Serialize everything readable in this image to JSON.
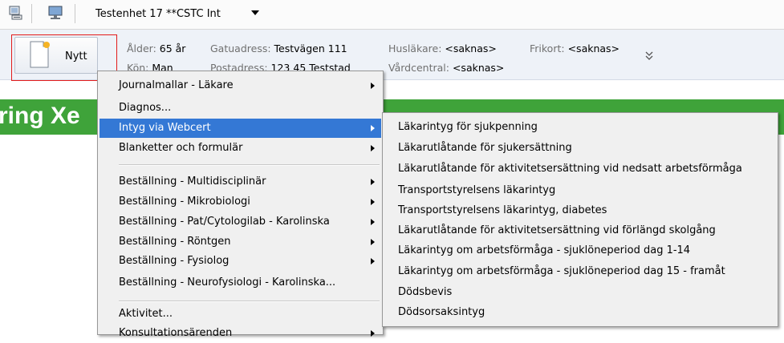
{
  "toolbar": {
    "unit_label": "Testenhet 17 **CSTC Int",
    "icons": [
      "keyboard-icon",
      "monitor-icon"
    ]
  },
  "patient": {
    "new_button_label": "Nytt",
    "age_label": "Ålder:",
    "age_value": "65 år",
    "gender_label": "Kön:",
    "gender_value": "Man",
    "street_label": "Gatuadress:",
    "street_value": "Testvägen 111",
    "postal_label": "Postadress:",
    "postal_value": "123 45 Teststad",
    "doctor_label": "Husläkare:",
    "doctor_value": "<saknas>",
    "clinic_label": "Vårdcentral:",
    "clinic_value": "<saknas>",
    "frikort_label": "Frikort:",
    "frikort_value": "<saknas>"
  },
  "banner": {
    "text": "ring Xe"
  },
  "menu": {
    "items": [
      {
        "label": "Journalmallar - Läkare",
        "submenu": true
      },
      {
        "label": "Diagnos...",
        "submenu": false
      },
      {
        "label": "Intyg via Webcert",
        "submenu": true,
        "selected": true
      },
      {
        "label": "Blanketter och formulär",
        "submenu": true
      },
      {
        "label": "Beställning - Multidisciplinär",
        "submenu": true
      },
      {
        "label": "Beställning - Mikrobiologi",
        "submenu": true
      },
      {
        "label": "Beställning - Pat/Cytologilab - Karolinska",
        "submenu": true
      },
      {
        "label": "Beställning - Röntgen",
        "submenu": true
      },
      {
        "label": "Beställning - Fysiolog",
        "submenu": true
      },
      {
        "label": "Beställning - Neurofysiologi - Karolinska...",
        "submenu": false
      },
      {
        "label": "Aktivitet...",
        "submenu": false
      },
      {
        "label": "Konsultationsärenden",
        "submenu": true
      }
    ]
  },
  "submenu": {
    "items": [
      "Läkarintyg för sjukpenning",
      "Läkarutlåtande för sjukersättning",
      "Läkarutlåtande för aktivitetsersättning vid nedsatt arbetsförmåga",
      "Transportstyrelsens läkarintyg",
      "Transportstyrelsens läkarintyg, diabetes",
      "Läkarutlåtande för aktivitetsersättning vid förlängd skolgång",
      "Läkarintyg om arbetsförmåga - sjuklöneperiod dag 1-14",
      "Läkarintyg om arbetsförmåga - sjuklöneperiod dag 15 - framåt",
      "Dödsbevis",
      "Dödsorsaksintyg"
    ]
  },
  "colors": {
    "selection": "#3478d5",
    "banner": "#3fa33a",
    "highlight_border": "#e31b1b"
  }
}
